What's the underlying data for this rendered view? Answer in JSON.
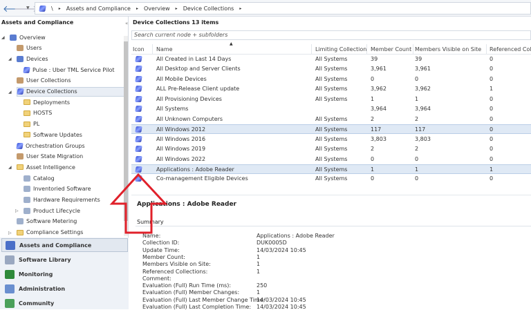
{
  "breadcrumb": {
    "root": "\\",
    "items": [
      "Assets and Compliance",
      "Overview",
      "Device Collections"
    ]
  },
  "left": {
    "title": "Assets and Compliance",
    "tree": [
      {
        "label": "Overview",
        "level": 0,
        "twisty": "◢",
        "icon": "overview"
      },
      {
        "label": "Users",
        "level": 1,
        "icon": "user"
      },
      {
        "label": "Devices",
        "level": 1,
        "twisty": "◢",
        "icon": "devices"
      },
      {
        "label": "Pulse : Uber TML Service Pilot",
        "level": 2,
        "icon": "collection"
      },
      {
        "label": "User Collections",
        "level": 1,
        "icon": "user"
      },
      {
        "label": "Device Collections",
        "level": 1,
        "twisty": "◢",
        "icon": "collection",
        "selected": true
      },
      {
        "label": "Deployments",
        "level": 2,
        "icon": "folder"
      },
      {
        "label": "HOSTS",
        "level": 2,
        "icon": "folder"
      },
      {
        "label": "PL",
        "level": 2,
        "icon": "folder"
      },
      {
        "label": "Software Updates",
        "level": 2,
        "icon": "folder"
      },
      {
        "label": "Orchestration Groups",
        "level": 1,
        "icon": "collection"
      },
      {
        "label": "User State Migration",
        "level": 1,
        "icon": "user"
      },
      {
        "label": "Asset Intelligence",
        "level": 1,
        "twisty": "◢",
        "icon": "folder"
      },
      {
        "label": "Catalog",
        "level": 2,
        "icon": "gen"
      },
      {
        "label": "Inventoried Software",
        "level": 2,
        "icon": "gen"
      },
      {
        "label": "Hardware Requirements",
        "level": 2,
        "icon": "gen"
      },
      {
        "label": "Product Lifecycle",
        "level": 2,
        "twisty": "▷",
        "icon": "gen"
      },
      {
        "label": "Software Metering",
        "level": 1,
        "icon": "gen"
      },
      {
        "label": "Compliance Settings",
        "level": 1,
        "twisty": "▷",
        "icon": "folder"
      }
    ],
    "workspaces": [
      {
        "label": "Assets and Compliance",
        "selected": true,
        "color": "#4a6fc8"
      },
      {
        "label": "Software Library",
        "color": "#9aa8c0"
      },
      {
        "label": "Monitoring",
        "color": "#2f8a3a"
      },
      {
        "label": "Administration",
        "color": "#6a8fcf"
      },
      {
        "label": "Community",
        "color": "#4aa05a"
      }
    ]
  },
  "list": {
    "title": "Device Collections 13 items",
    "search_placeholder": "Search current node + subfolders",
    "columns": [
      "Icon",
      "Name",
      "Limiting Collection",
      "Member Count",
      "Members Visible on Site",
      "Referenced Colle"
    ],
    "rows": [
      [
        "All Created in Last 14 Days",
        "All Systems",
        "39",
        "39",
        "0"
      ],
      [
        "All Desktop and Server Clients",
        "All Systems",
        "3,961",
        "3,961",
        "0"
      ],
      [
        "All Mobile Devices",
        "All Systems",
        "0",
        "0",
        "0"
      ],
      [
        "ALL Pre-Release Client update",
        "All Systems",
        "3,962",
        "3,962",
        "1"
      ],
      [
        "All Provisioning Devices",
        "All Systems",
        "1",
        "1",
        "0"
      ],
      [
        "All Systems",
        "",
        "3,964",
        "3,964",
        "0"
      ],
      [
        "All Unknown Computers",
        "All Systems",
        "2",
        "2",
        "0"
      ],
      [
        "All Windows 2012",
        "All Systems",
        "117",
        "117",
        "0"
      ],
      [
        "All Windows 2016",
        "All Systems",
        "3,803",
        "3,803",
        "0"
      ],
      [
        "All Windows 2019",
        "All Systems",
        "2",
        "2",
        "0"
      ],
      [
        "All Windows 2022",
        "All Systems",
        "0",
        "0",
        "0"
      ],
      [
        "Applications : Adobe Reader",
        "All Systems",
        "1",
        "1",
        "1"
      ],
      [
        "Co-management Eligible Devices",
        "All Systems",
        "0",
        "0",
        "0"
      ]
    ],
    "highlighted_rows": [
      7,
      11
    ]
  },
  "detail": {
    "title": "Applications : Adobe Reader",
    "section": "Summary",
    "fields": [
      [
        "Name:",
        "Applications : Adobe Reader"
      ],
      [
        "Collection ID:",
        "DUK0005D"
      ],
      [
        "Update Time:",
        "14/03/2024 10:45"
      ],
      [
        "Member Count:",
        "1"
      ],
      [
        "Members Visible on Site:",
        "1"
      ],
      [
        "Referenced Collections:",
        "1"
      ],
      [
        "Comment:",
        ""
      ],
      [
        "Evaluation (Full) Run Time (ms):",
        "250"
      ],
      [
        "Evaluation (Full) Member Changes:",
        "1"
      ],
      [
        "Evaluation (Full) Last Member Change Time:",
        "14/03/2024 10:45"
      ],
      [
        "Evaluation (Full) Last Completion Time:",
        "14/03/2024 10:45"
      ]
    ]
  },
  "annotation_color": "#e0202a"
}
